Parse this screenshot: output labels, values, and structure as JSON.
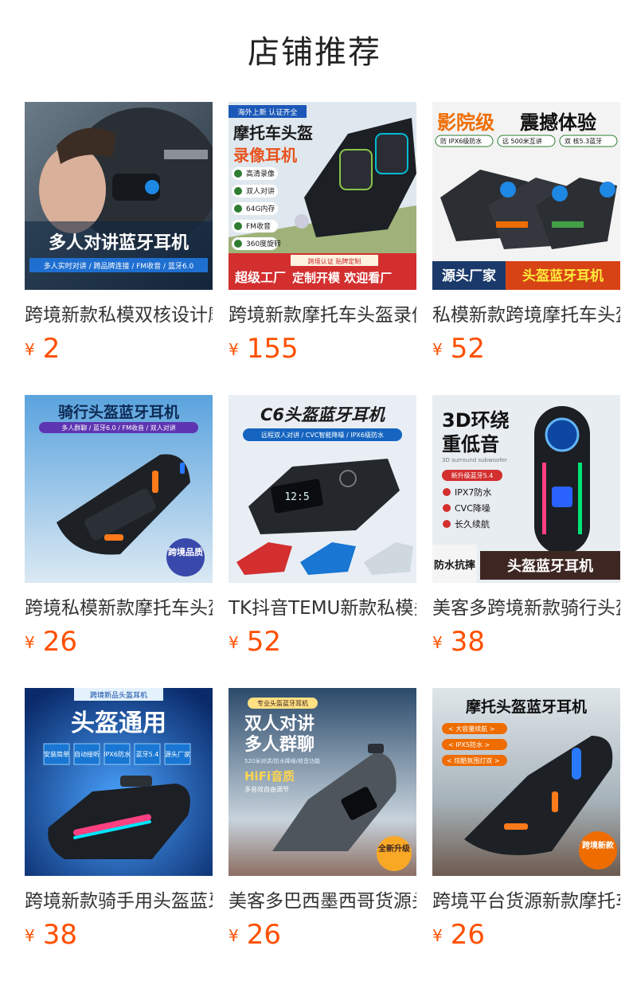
{
  "page": {
    "title": "店铺推荐"
  },
  "currency": "¥",
  "products": [
    {
      "title": "跨境新款私模双核设计摩托车头盔蓝牙耳机",
      "price": "2",
      "image": {
        "icon": "helmet-rider-icon",
        "bg": "#2c3e50",
        "headline": "多人对讲蓝牙耳机",
        "subline": "多人实时对讲 / 跨品牌连接 / FM收音 / 蓝牙6.0"
      }
    },
    {
      "title": "跨境新款摩托车头盔录像耳机",
      "price": "155",
      "image": {
        "icon": "headset-device-icon",
        "bg": "#dfe8ee",
        "badge": "海外上新 认证齐全",
        "headline1": "摩托车头盔",
        "headline2": "录像耳机",
        "features": [
          "高清录像",
          "双人对讲",
          "64G内存",
          "FM收音",
          "360度旋转"
        ],
        "banner_left": "超级工厂",
        "banner_tag": "跨境认证 贴牌定制",
        "banner_right": "定制开模 欢迎看厂"
      }
    },
    {
      "title": "私模新款跨境摩托车头盔蓝牙耳机",
      "price": "52",
      "image": {
        "icon": "headset-device-icon",
        "bg": "#f3f3f3",
        "headline1": "影院级",
        "headline2": "震撼体验",
        "chips": [
          "防 IPX6级防水",
          "远 500米互讲",
          "双 核5.3蓝牙"
        ],
        "banner_left": "源头厂家",
        "banner_right": "头盔蓝牙耳机"
      }
    },
    {
      "title": "跨境私模新款摩托车头盔蓝牙耳机",
      "price": "26",
      "image": {
        "icon": "headset-device-icon",
        "bg": "#8fc3ea",
        "headline": "骑行头盔蓝牙耳机",
        "subline": "多人群聊 / 蓝牙6.0 / FM收音 / 双人对讲",
        "badge": "跨境品质"
      }
    },
    {
      "title": "TK抖音TEMU新款私模头盔蓝牙耳机",
      "price": "52",
      "image": {
        "icon": "headset-device-icon",
        "bg": "#e9eef5",
        "headline": "C6头盔蓝牙耳机",
        "subline": "远程双人对讲 / CVC智能降噪 / IPX6级防水",
        "screen": "12:5"
      }
    },
    {
      "title": "美客多跨境新款骑行头盔蓝牙耳机",
      "price": "38",
      "image": {
        "icon": "headset-device-icon",
        "bg": "#e8edf2",
        "headline1": "3D环绕",
        "headline2": "重低音",
        "caption": "3D surround subwoofer",
        "pill": "新升级蓝牙5.4",
        "features": [
          "IPX7防水",
          "CVC降噪",
          "长久续航"
        ],
        "banner_left": "防水抗摔",
        "banner_right": "头盔蓝牙耳机"
      }
    },
    {
      "title": "跨境新款骑手用头盔蓝牙耳机",
      "price": "38",
      "image": {
        "icon": "headset-device-icon",
        "bg": "#0f3f86",
        "badge": "跨境新品头盔耳机",
        "headline": "头盔通用",
        "chips": [
          "安装简单",
          "自动接听",
          "IPX6防水",
          "蓝牙5.4",
          "源头厂家"
        ]
      }
    },
    {
      "title": "美客多巴西墨西哥货源头盔蓝牙耳机",
      "price": "26",
      "image": {
        "icon": "headset-device-icon",
        "bg": "#2b4a6b",
        "badge": "专业头盔蓝牙耳机",
        "headline1": "双人对讲",
        "headline2": "多人群聊",
        "subline": "520米对讲/防水降噪/收音功能",
        "highlight": "HiFi音质",
        "caption": "多音效自由调节",
        "seal": "全新升级"
      }
    },
    {
      "title": "跨境平台货源新款摩托车头盔蓝牙耳机",
      "price": "26",
      "image": {
        "icon": "headset-device-icon",
        "bg": "#b8c4cc",
        "headline": "摩托头盔蓝牙耳机",
        "tags": [
          "< 大容量续航 >",
          "< IPX5防水 >",
          "< 炫酷氛围灯双 >"
        ],
        "seal": "跨境新款"
      }
    }
  ]
}
